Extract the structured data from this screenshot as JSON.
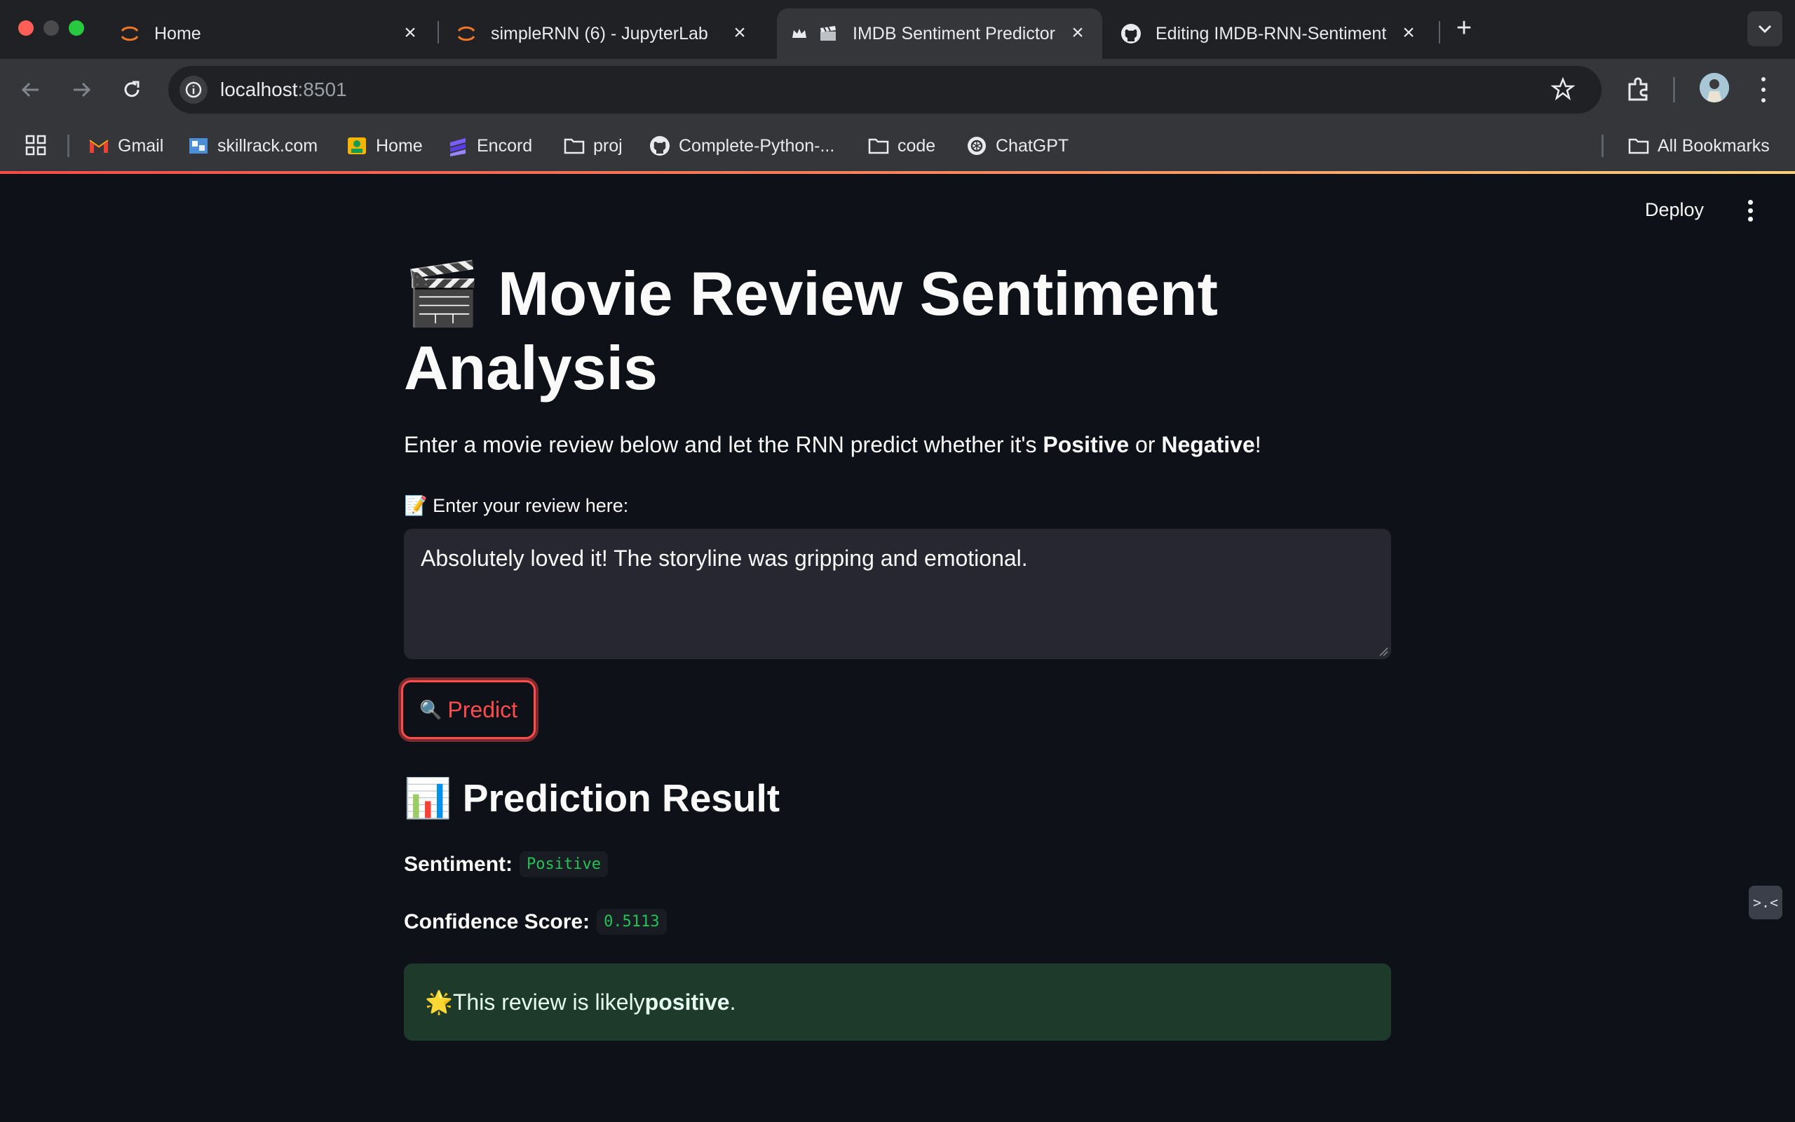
{
  "browser": {
    "tabs": [
      {
        "title": "Home",
        "icon": "jupyter-icon",
        "active": false
      },
      {
        "title": "simpleRNN (6) - JupyterLab",
        "icon": "jupyter-icon",
        "active": false
      },
      {
        "title": "IMDB Sentiment Predictor",
        "icon": "clapper-icon",
        "active": true
      },
      {
        "title": "Editing IMDB-RNN-Sentiment",
        "icon": "github-icon",
        "active": false
      }
    ],
    "new_tab_symbol": "+",
    "url": {
      "host": "localhost",
      "port": ":8501"
    },
    "bookmarks": [
      {
        "label": "Gmail",
        "icon": "gmail-icon"
      },
      {
        "label": "skillrack.com",
        "icon": "skillrack-icon"
      },
      {
        "label": "Home",
        "icon": "home-app-icon"
      },
      {
        "label": "Encord",
        "icon": "encord-icon"
      },
      {
        "label": "proj",
        "icon": "folder-icon"
      },
      {
        "label": "Complete-Python-...",
        "icon": "github-icon"
      },
      {
        "label": "code",
        "icon": "folder-icon"
      },
      {
        "label": "ChatGPT",
        "icon": "chatgpt-icon"
      }
    ],
    "all_bookmarks_label": "All Bookmarks",
    "colors": {
      "tab_bar": "#202124",
      "toolbar": "#35363a",
      "accent_line": "#ff4b4b"
    }
  },
  "app": {
    "deploy_label": "Deploy",
    "title": "🎬 Movie Review Sentiment Analysis",
    "intro": {
      "before": "Enter a movie review below and let the RNN predict whether it's ",
      "positive": "Positive",
      "middle": " or ",
      "negative": "Negative",
      "after": "!"
    },
    "review_label": "📝 Enter your review here:",
    "review_text": "Absolutely loved it! The storyline was gripping and emotional.",
    "predict_icon": "🔍",
    "predict_label": "Predict",
    "result_heading": "📊 Prediction Result",
    "sentiment_label": "Sentiment:",
    "sentiment_value": "Positive",
    "confidence_label": "Confidence Score:",
    "confidence_value": "0.5113",
    "success": {
      "icon": "🌟",
      "before": " This review is likely ",
      "bold": "positive",
      "after": "."
    },
    "side_widget_text": ">.<",
    "colors": {
      "background": "#0e1117",
      "primary": "#ff4b4b",
      "input_bg": "#262730",
      "success_bg": "#1e3a2a",
      "code_green": "#21c354"
    }
  }
}
